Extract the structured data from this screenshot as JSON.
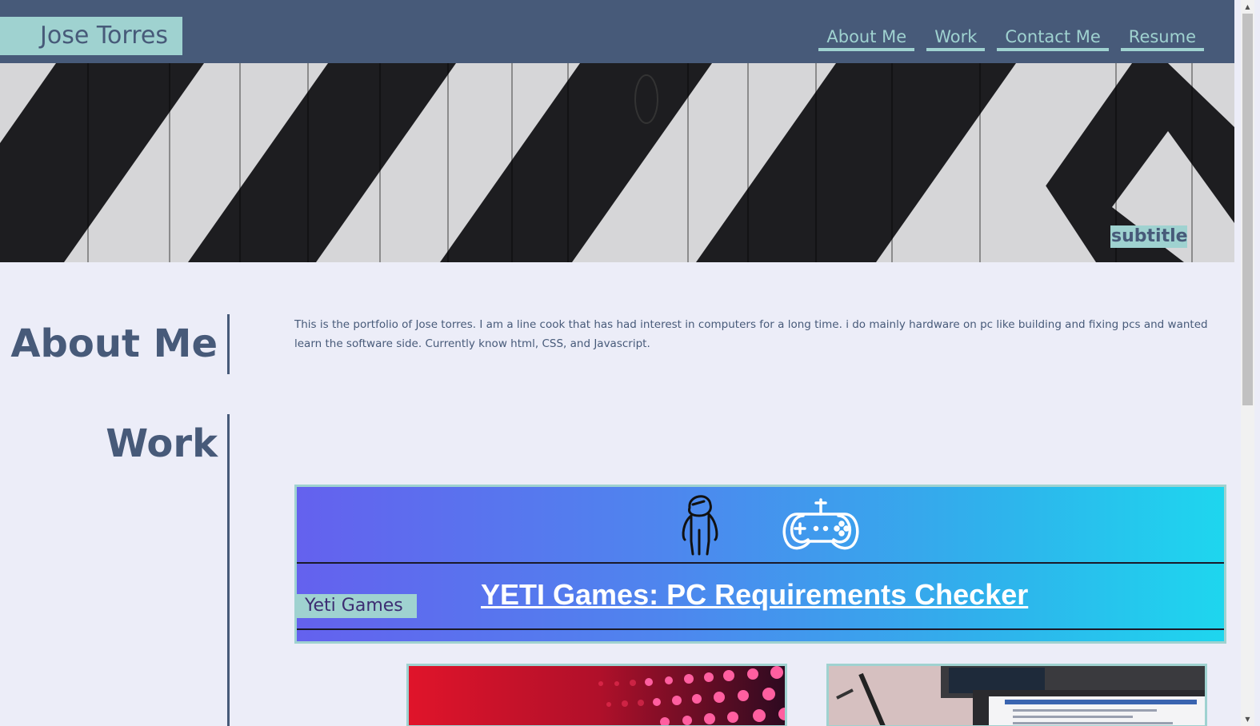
{
  "header": {
    "brand": "Jose Torres",
    "nav": [
      "About Me",
      "Work",
      "Contact Me",
      "Resume"
    ]
  },
  "hero": {
    "subtitle": "subtitle"
  },
  "about": {
    "title": "About Me",
    "text": "This is the portfolio of Jose torres. I am a line cook that has had interest in computers for a long time. i do mainly hardware on pc like building and fixing pcs and wanted learn the software side. Currently know html, CSS, and Javascript."
  },
  "work": {
    "title": "Work",
    "featured": {
      "title": "YETI Games: PC Requirements Checker",
      "label": "Yeti Games",
      "icons": [
        "yeti-icon",
        "gamepad-icon"
      ]
    },
    "cards": [
      {
        "image": "led-lights-image"
      },
      {
        "image": "laptop-screen-image"
      }
    ]
  },
  "colors": {
    "header_bg": "#475a79",
    "accent": "#9fd2d0",
    "page_bg": "#ecedf8",
    "gradient_start": "#6461ee",
    "gradient_end": "#1ed6ee"
  }
}
